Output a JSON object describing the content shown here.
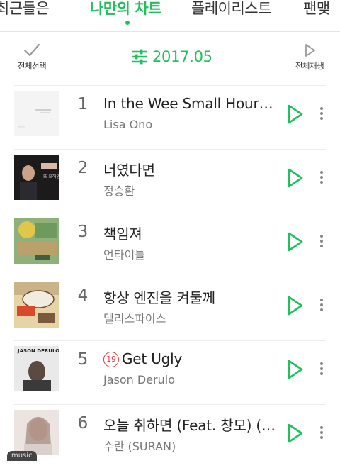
{
  "tabs": [
    {
      "label": "최근들은"
    },
    {
      "label": "나만의 차트"
    },
    {
      "label": "플레이리스트"
    },
    {
      "label": "팬맺"
    }
  ],
  "toolbar": {
    "select_all_label": "전체선택",
    "date": "2017.05",
    "play_all_label": "전체재생"
  },
  "songs": [
    {
      "rank": "1",
      "title": "In the Wee Small Hours of the Morning",
      "artist": "Lisa Ono"
    },
    {
      "rank": "2",
      "title": "너였다면",
      "artist": "정승환"
    },
    {
      "rank": "3",
      "title": "책임져",
      "artist": "언타이틀"
    },
    {
      "rank": "4",
      "title": "항상 엔진을 켜둘께",
      "artist": "델리스파이스"
    },
    {
      "rank": "5",
      "badge": "19",
      "title": "Get Ugly",
      "artist": "Jason Derulo"
    },
    {
      "rank": "6",
      "title": "오늘 취하면 (Feat. 창모) (Prod. SUGA)",
      "artist": "수란 (SURAN)"
    }
  ],
  "covers": {
    "album_2_text": "또 오해영",
    "album_5_text": "JASON DERULO"
  },
  "watermark": "music",
  "colors": {
    "accent": "#1fc15a",
    "age_badge": "#e0393e"
  },
  "icons": {
    "select_all": "checkmark-icon",
    "filter": "sliders-icon",
    "play_all": "play-outline-icon",
    "play": "play-icon",
    "more": "more-vertical-icon"
  }
}
